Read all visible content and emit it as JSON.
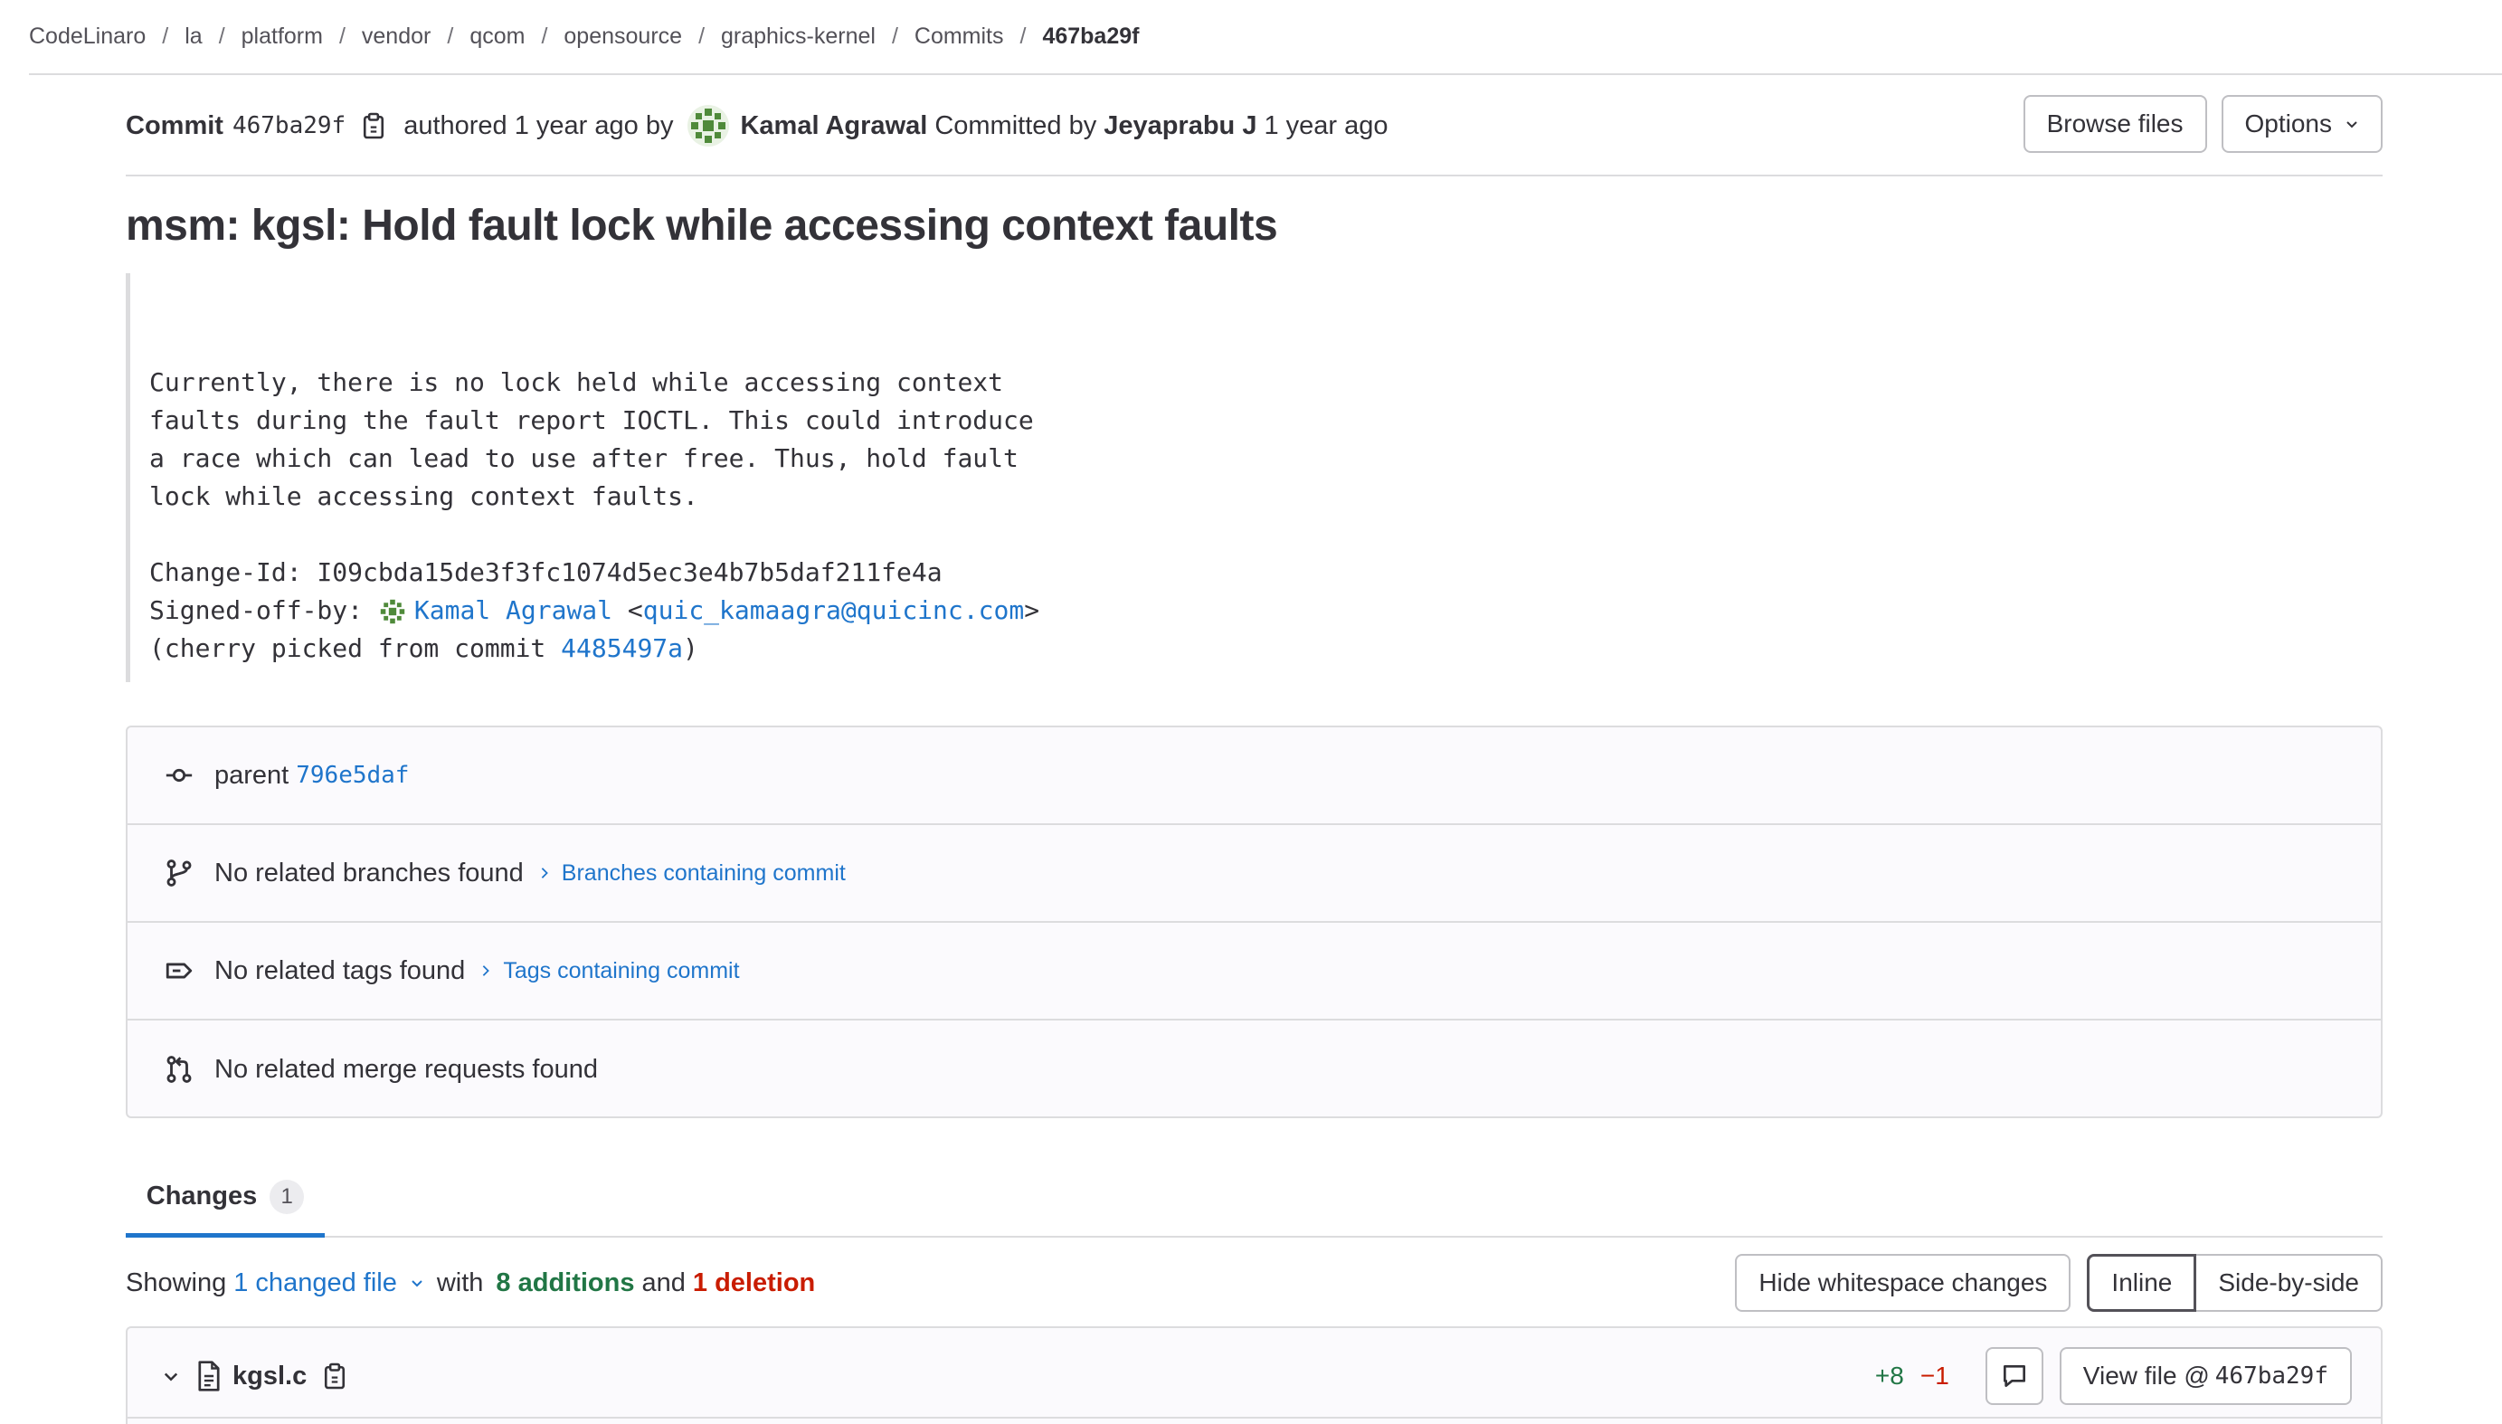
{
  "breadcrumb": [
    "CodeLinaro",
    "la",
    "platform",
    "vendor",
    "qcom",
    "opensource",
    "graphics-kernel",
    "Commits",
    "467ba29f"
  ],
  "commit": {
    "label": "Commit",
    "sha": "467ba29f",
    "authored_text": "authored 1 year ago by",
    "author": "Kamal Agrawal",
    "committed_by_text": "Committed by",
    "committer": "Jeyaprabu J",
    "committed_time": "1 year ago",
    "title": "msm: kgsl: Hold fault lock while accessing context faults"
  },
  "actions": {
    "browse_files": "Browse files",
    "options": "Options"
  },
  "description": {
    "body": "Currently, there is no lock held while accessing context\nfaults during the fault report IOCTL. This could introduce\na race which can lead to use after free. Thus, hold fault\nlock while accessing context faults.",
    "change_id": "Change-Id: I09cbda15de3f3fc1074d5ec3e4b7b5daf211fe4a",
    "signed_off_label": "Signed-off-by: ",
    "signed_off_name": "Kamal Agrawal",
    "signed_off_email_open": " <",
    "signed_off_email": "quic_kamaagra@quicinc.com",
    "signed_off_email_close": ">",
    "cherry_prefix": "(cherry picked from commit ",
    "cherry_sha": "4485497a",
    "cherry_suffix": ")"
  },
  "info": {
    "parent_label": "parent",
    "parent_sha": "796e5daf",
    "branches": "No related branches found",
    "branches_link": "Branches containing commit",
    "tags": "No related tags found",
    "tags_link": "Tags containing commit",
    "merge_requests": "No related merge requests found"
  },
  "tabs": {
    "changes": "Changes",
    "changes_count": "1"
  },
  "summary": {
    "showing": "Showing",
    "changed_files": "1 changed file",
    "with": "with",
    "additions": "8 additions",
    "and": "and",
    "deletions": "1 deletion"
  },
  "view": {
    "hide_whitespace": "Hide whitespace changes",
    "inline": "Inline",
    "side_by_side": "Side-by-side"
  },
  "file": {
    "name": "kgsl.c",
    "added": "+8",
    "removed": "−1",
    "view_file": "View file @ ",
    "view_file_sha": "467ba29f"
  },
  "colors": {
    "link": "#1f75cb",
    "addition": "#217645",
    "deletion": "#c91c00",
    "border": "#dcdcde",
    "avatar": "#4f8a3a"
  },
  "icons": [
    "clipboard-icon",
    "avatar-icon",
    "chevron-down-icon",
    "commit-icon",
    "branch-icon",
    "label-icon",
    "merge-request-icon",
    "chevron-right-icon",
    "file-icon",
    "comment-icon"
  ]
}
